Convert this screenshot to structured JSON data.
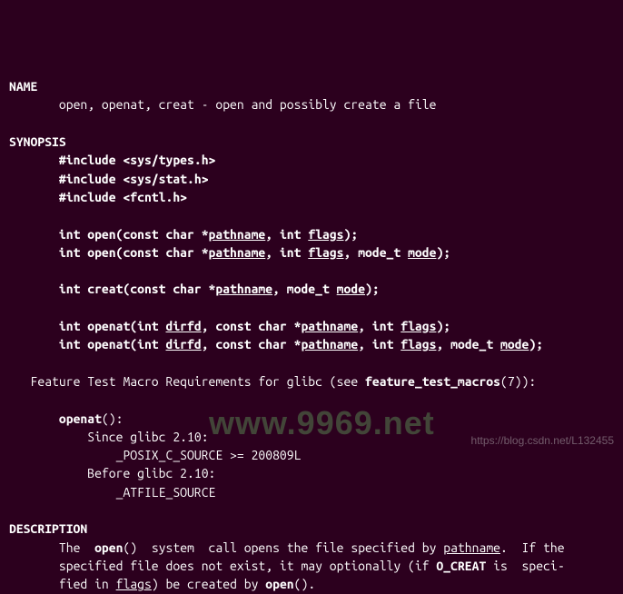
{
  "sections": {
    "name_hdr": "NAME",
    "name_body": "open, openat, creat - open and possibly create a file",
    "syn_hdr": "SYNOPSIS",
    "inc1_a": "#include <sys/types.h>",
    "inc2_a": "#include <sys/stat.h>",
    "inc3_a": "#include <fcntl.h>",
    "fn1": {
      "pre": "int open(const char *",
      "p1": "pathname",
      "mid1": ", int ",
      "p2": "flags",
      "tail": ");"
    },
    "fn2": {
      "pre": "int open(const char *",
      "p1": "pathname",
      "mid1": ", int ",
      "p2": "flags",
      "mid2": ", mode_t ",
      "p3": "mode",
      "tail": ");"
    },
    "fn3": {
      "pre": "int creat(const char *",
      "p1": "pathname",
      "mid1": ", mode_t ",
      "p2": "mode",
      "tail": ");"
    },
    "fn4": {
      "pre": "int openat(int ",
      "p1": "dirfd",
      "mid1": ", const char *",
      "p2": "pathname",
      "mid2": ", int ",
      "p3": "flags",
      "tail": ");"
    },
    "fn5": {
      "pre": "int openat(int ",
      "p1": "dirfd",
      "mid1": ", const char *",
      "p2": "pathname",
      "mid2": ", int ",
      "p3": "flags",
      "mid3": ", mode_t ",
      "p4": "mode",
      "tail": ");"
    },
    "ftm_pre": "Feature Test Macro Requirements for glibc (see ",
    "ftm_b": "feature_test_macros",
    "ftm_post": "(7)):",
    "oa": "openat",
    "oa_tail": "():",
    "since": "Since glibc 2.10:",
    "since_def": "_POSIX_C_SOURCE >= 200809L",
    "before": "Before glibc 2.10:",
    "before_def": "_ATFILE_SOURCE",
    "desc_hdr": "DESCRIPTION",
    "d1a": "The  ",
    "d1b": "open",
    "d1c": "()  system  call opens the file specified by ",
    "d1d": "pathname",
    "d1e": ".  If the",
    "d2a": "specified file does not exist, it may optionally (if ",
    "d2b": "O_CREAT",
    "d2c": " is  speci‐",
    "d3a": "fied in ",
    "d3b": "flags",
    "d3c": ") be created by ",
    "d3d": "open",
    "d3e": "()."
  },
  "watermark": {
    "logo": "www.9969.net",
    "url": "https://blog.csdn.net/L132455"
  }
}
